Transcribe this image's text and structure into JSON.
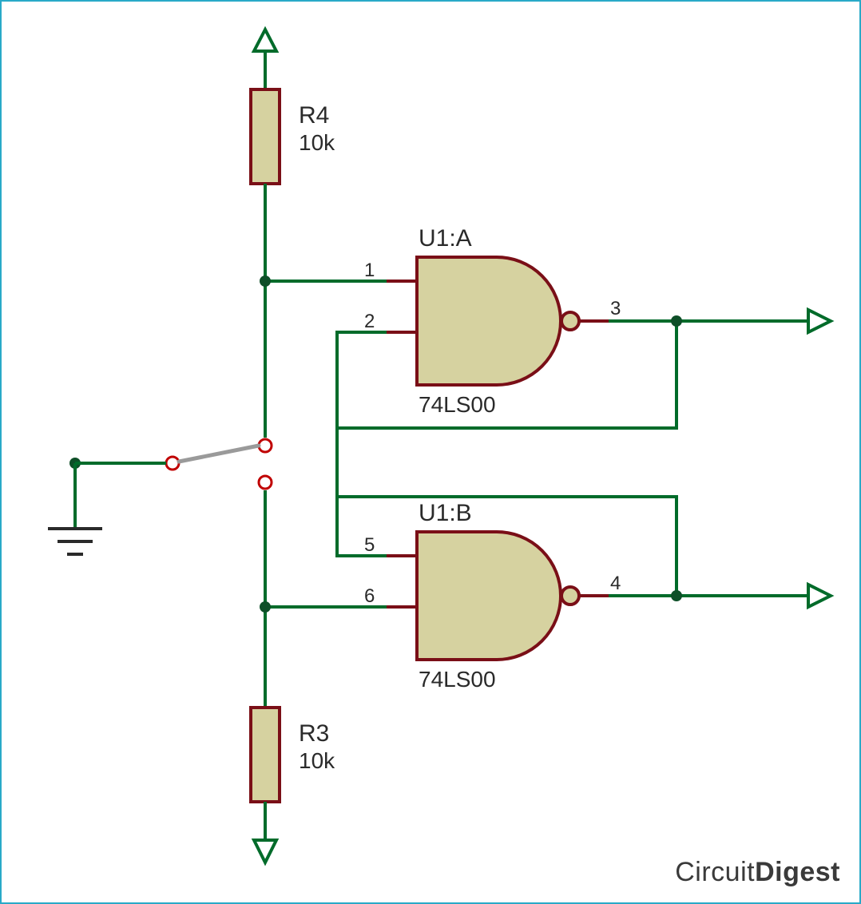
{
  "components": {
    "R4": {
      "ref": "R4",
      "value": "10k"
    },
    "R3": {
      "ref": "R3",
      "value": "10k"
    },
    "U1A": {
      "ref": "U1:A",
      "part": "74LS00",
      "pins": {
        "in1": "1",
        "in2": "2",
        "out": "3"
      }
    },
    "U1B": {
      "ref": "U1:B",
      "part": "74LS00",
      "pins": {
        "in1": "5",
        "in2": "6",
        "out": "4"
      }
    }
  },
  "watermark": {
    "left": "Circuit",
    "right": "Digest"
  }
}
